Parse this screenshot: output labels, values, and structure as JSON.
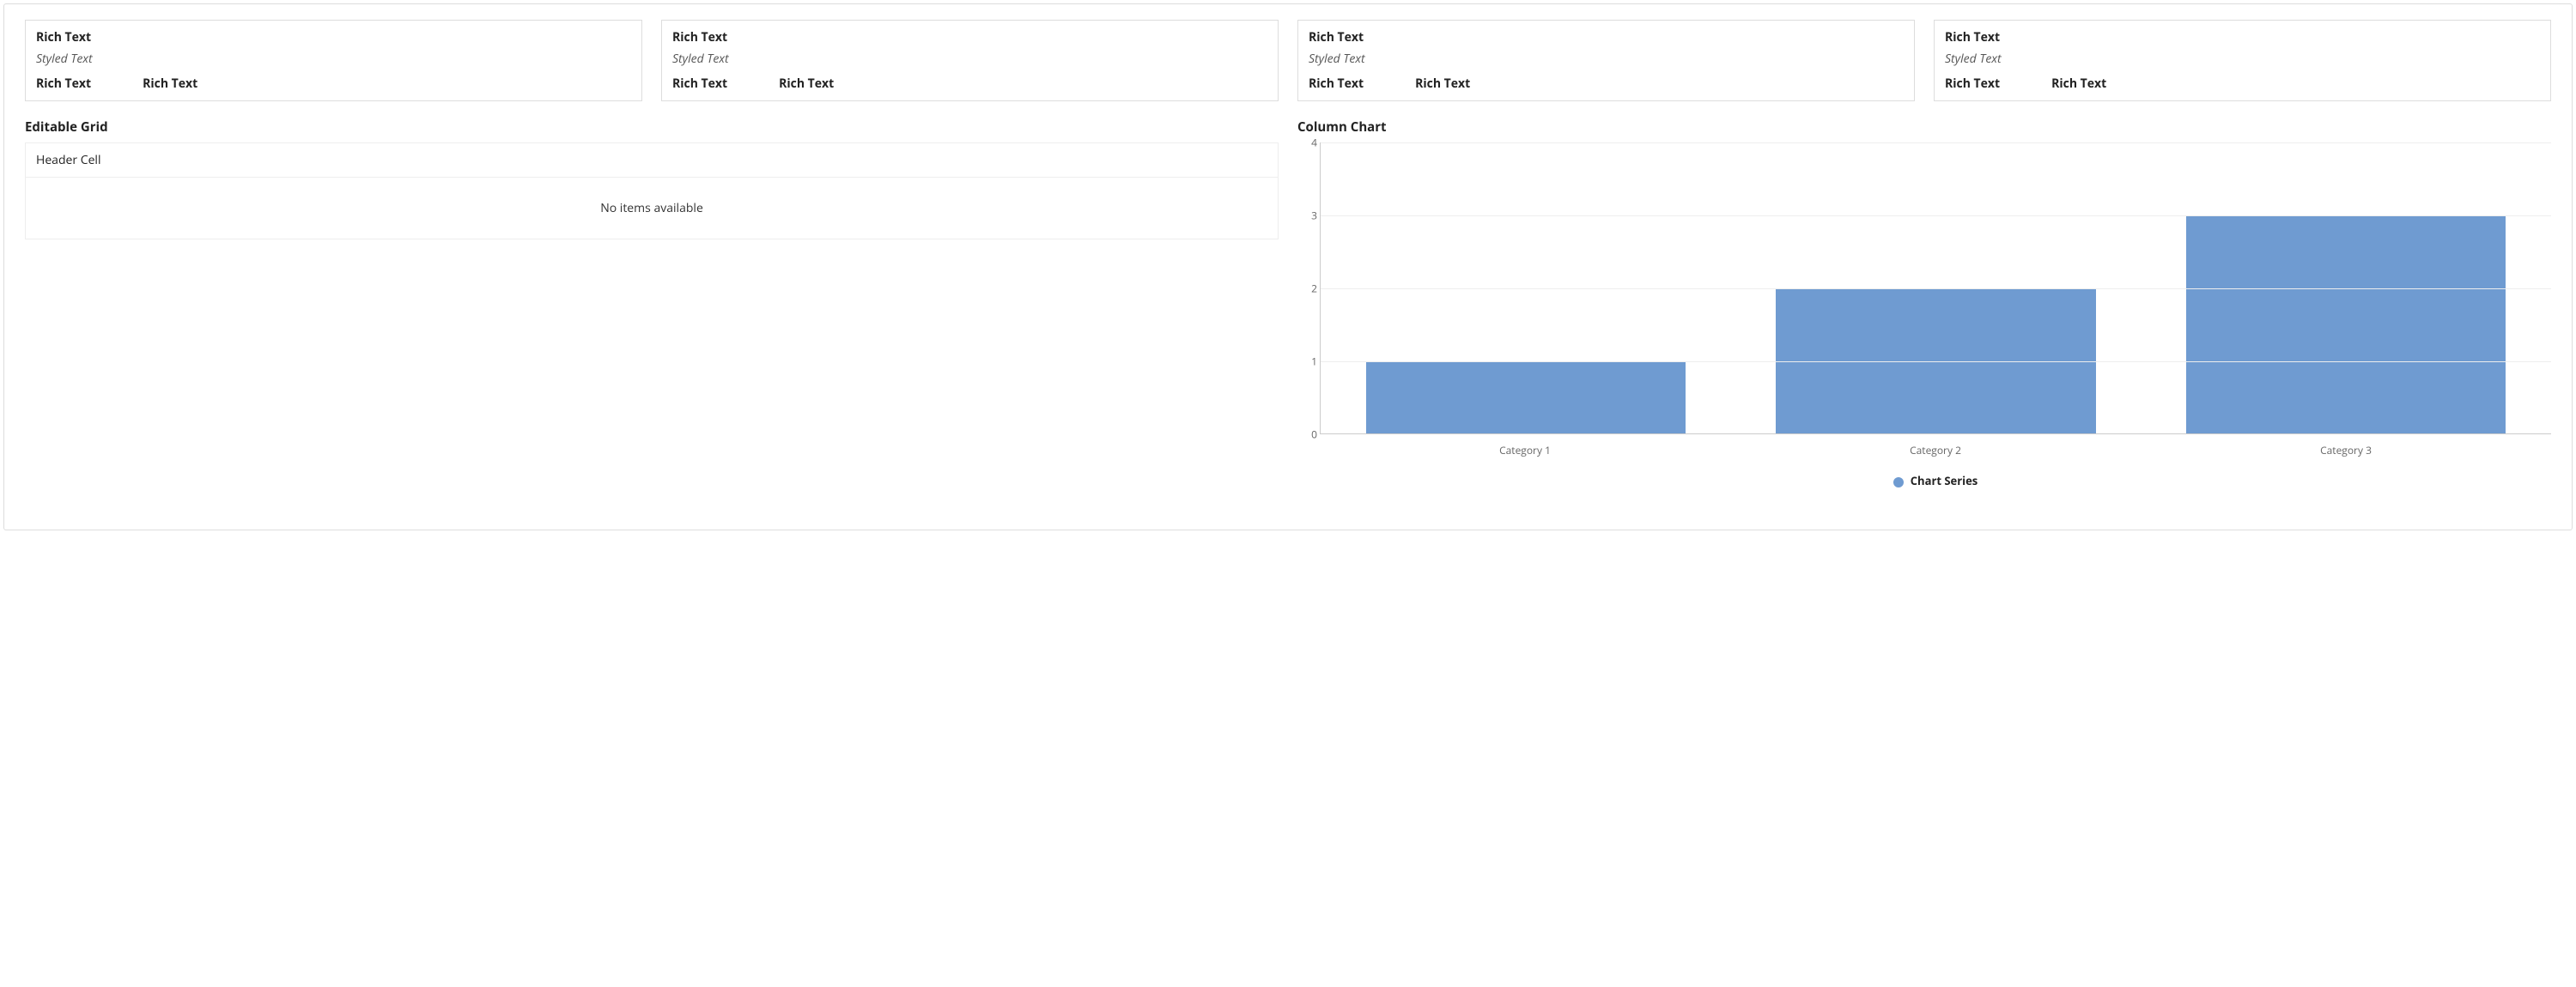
{
  "cards": [
    {
      "title": "Rich Text",
      "styled": "Styled Text",
      "left": "Rich Text",
      "right": "Rich Text"
    },
    {
      "title": "Rich Text",
      "styled": "Styled Text",
      "left": "Rich Text",
      "right": "Rich Text"
    },
    {
      "title": "Rich Text",
      "styled": "Styled Text",
      "left": "Rich Text",
      "right": "Rich Text"
    },
    {
      "title": "Rich Text",
      "styled": "Styled Text",
      "left": "Rich Text",
      "right": "Rich Text"
    }
  ],
  "grid": {
    "section_title": "Editable Grid",
    "header": "Header Cell",
    "empty_message": "No items available"
  },
  "chart_section": {
    "title": "Column Chart",
    "legend_label": "Chart Series"
  },
  "chart_data": {
    "type": "bar",
    "categories": [
      "Category 1",
      "Category 2",
      "Category 3"
    ],
    "values": [
      1,
      2,
      3
    ],
    "series_name": "Chart Series",
    "ylim": [
      0,
      4
    ],
    "yticks": [
      0,
      1,
      2,
      3,
      4
    ],
    "bar_color": "#6f9bd1"
  }
}
